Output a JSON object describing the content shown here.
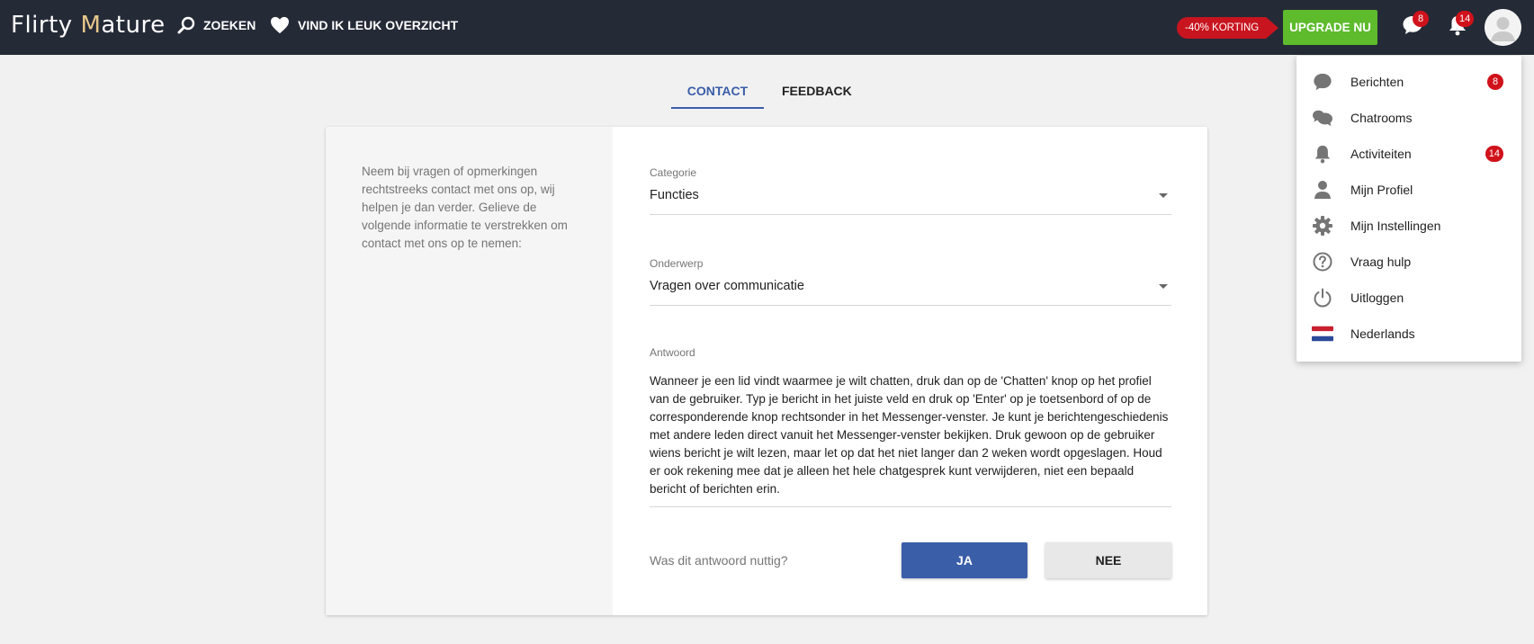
{
  "header": {
    "logo_part1": "Flirty ",
    "logo_accent": "M",
    "logo_part2": "ature",
    "nav": [
      {
        "label": "ZOEKEN",
        "icon": "search-icon"
      },
      {
        "label": "VIND IK LEUK OVERZICHT",
        "icon": "heart-icon"
      }
    ],
    "discount_label": "-40% KORTING",
    "upgrade_label": "UPGRADE NU",
    "messages_badge": "8",
    "notifications_badge": "14"
  },
  "tabs": [
    {
      "label": "CONTACT",
      "active": true
    },
    {
      "label": "FEEDBACK",
      "active": false
    }
  ],
  "contact": {
    "intro": "Neem bij vragen of opmerkingen rechtstreeks contact met ons op, wij helpen je dan verder. Gelieve de volgende informatie te verstrekken om contact met ons op te nemen:",
    "category_label": "Categorie",
    "category_value": "Functies",
    "subject_label": "Onderwerp",
    "subject_value": "Vragen over communicatie",
    "answer_label": "Antwoord",
    "answer_text": "Wanneer je een lid vindt waarmee je wilt chatten, druk dan op de 'Chatten' knop op het profiel van de gebruiker. Typ je bericht in het juiste veld en druk op 'Enter' op je toetsenbord of op de corresponderende knop rechtsonder in het Messenger-venster. Je kunt je berichtengeschiedenis met andere leden direct vanuit het Messenger-venster bekijken. Druk gewoon op de gebruiker wiens bericht je wilt lezen, maar let op dat het niet langer dan 2 weken wordt opgeslagen. Houd er ook rekening mee dat je alleen het hele chatgesprek kunt verwijderen, niet een bepaald bericht of berichten erin.",
    "helpful_question": "Was dit antwoord nuttig?",
    "yes_label": "JA",
    "no_label": "NEE"
  },
  "menu": {
    "items": [
      {
        "label": "Berichten",
        "icon": "chat-bubble-icon",
        "badge": "8"
      },
      {
        "label": "Chatrooms",
        "icon": "chatrooms-icon"
      },
      {
        "label": "Activiteiten",
        "icon": "bell-icon",
        "badge": "14"
      },
      {
        "label": "Mijn Profiel",
        "icon": "person-icon"
      },
      {
        "label": "Mijn Instellingen",
        "icon": "gear-icon"
      },
      {
        "label": "Vraag hulp",
        "icon": "help-icon"
      },
      {
        "label": "Uitloggen",
        "icon": "power-icon"
      },
      {
        "label": "Nederlands",
        "icon": "dutch-flag-icon"
      }
    ]
  },
  "colors": {
    "header_bg": "#252a37",
    "accent_blue": "#3a5ea8",
    "upgrade_green": "#5dbb2c",
    "badge_red": "#d0121b"
  }
}
